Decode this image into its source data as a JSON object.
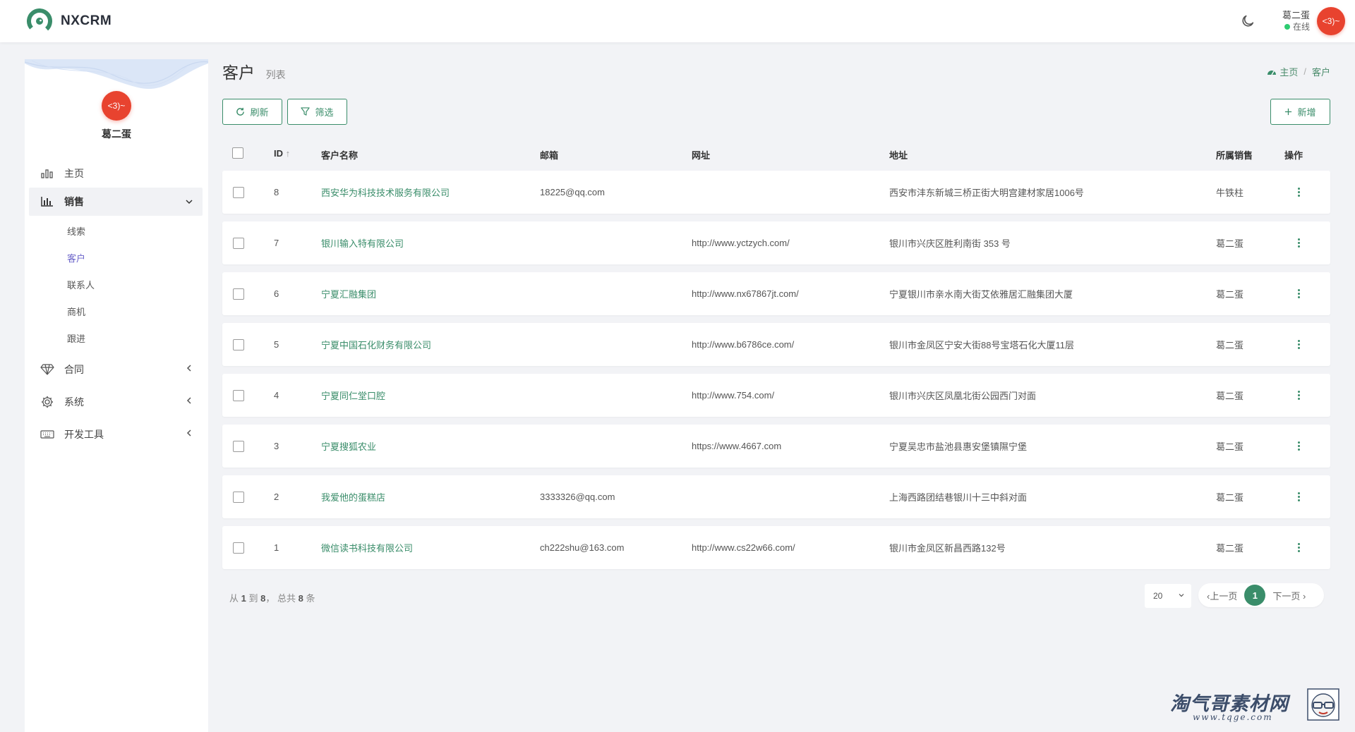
{
  "app": {
    "name": "NXCRM"
  },
  "user": {
    "name": "葛二蛋",
    "status": "在线",
    "avatar_text": "<3)~"
  },
  "sidebar": {
    "user_name": "葛二蛋",
    "avatar_text": "<3)~",
    "items": [
      {
        "label": "主页",
        "icon": "bar-chart-icon"
      },
      {
        "label": "销售",
        "icon": "column-chart-icon",
        "expanded": true,
        "children": [
          {
            "label": "线索"
          },
          {
            "label": "客户",
            "current": true
          },
          {
            "label": "联系人"
          },
          {
            "label": "商机"
          },
          {
            "label": "跟进"
          }
        ]
      },
      {
        "label": "合同",
        "icon": "diamond-icon"
      },
      {
        "label": "系统",
        "icon": "gear-icon"
      },
      {
        "label": "开发工具",
        "icon": "keyboard-icon"
      }
    ]
  },
  "page": {
    "title": "客户",
    "subtitle": "列表"
  },
  "breadcrumb": {
    "home": "主页",
    "current": "客户"
  },
  "toolbar": {
    "refresh_label": "刷新",
    "filter_label": "筛选",
    "add_label": "新增"
  },
  "table": {
    "headers": {
      "id": "ID",
      "name": "客户名称",
      "email": "邮箱",
      "url": "网址",
      "address": "地址",
      "sales": "所属销售",
      "op": "操作"
    },
    "rows": [
      {
        "id": "8",
        "name": "西安华为科技技术服务有限公司",
        "email": "18225@qq.com",
        "url": "",
        "address": "西安市沣东新城三桥正街大明宫建材家居1006号",
        "sales": "牛铁柱"
      },
      {
        "id": "7",
        "name": "银川输入特有限公司",
        "email": "",
        "url": "http://www.yctzych.com/",
        "address": "银川市兴庆区胜利南街 353 号",
        "sales": "葛二蛋"
      },
      {
        "id": "6",
        "name": "宁夏汇融集团",
        "email": "",
        "url": "http://www.nx67867jt.com/",
        "address": "宁夏银川市亲水南大街艾依雅居汇融集团大厦",
        "sales": "葛二蛋"
      },
      {
        "id": "5",
        "name": "宁夏中国石化财务有限公司",
        "email": "",
        "url": "http://www.b6786ce.com/",
        "address": "银川市金凤区宁安大街88号宝塔石化大厦11层",
        "sales": "葛二蛋"
      },
      {
        "id": "4",
        "name": "宁夏同仁堂口腔",
        "email": "",
        "url": "http://www.754.com/",
        "address": "银川市兴庆区凤凰北街公园西门对面",
        "sales": "葛二蛋"
      },
      {
        "id": "3",
        "name": "宁夏搜狐农业",
        "email": "",
        "url": "https://www.4667.com",
        "address": "宁夏吴忠市盐池县惠安堡镇隰宁堡",
        "sales": "葛二蛋"
      },
      {
        "id": "2",
        "name": "我爱他的蛋糕店",
        "email": "3333326@qq.com",
        "url": "",
        "address": "上海西路团结巷银川十三中斜对面",
        "sales": "葛二蛋"
      },
      {
        "id": "1",
        "name": "微信读书科技有限公司",
        "email": "ch222shu@163.com",
        "url": "http://www.cs22w66.com/",
        "address": "银川市金凤区新昌西路132号",
        "sales": "葛二蛋"
      }
    ]
  },
  "footer": {
    "summary_prefix": "从",
    "from": "1",
    "summary_to": "到",
    "to": "8",
    "summary_total": "，  总共",
    "total": "8",
    "summary_unit": "条",
    "page_size": "20",
    "prev_label": "上一页",
    "current_page": "1",
    "next_label": "下一页"
  },
  "watermark": {
    "text": "淘气哥素材网",
    "url": "www.tqge.com"
  },
  "colors": {
    "accent": "#3a8d6a",
    "avatar": "#e8432f",
    "submenu_active": "#6a63c9",
    "online": "#2ecc71"
  }
}
